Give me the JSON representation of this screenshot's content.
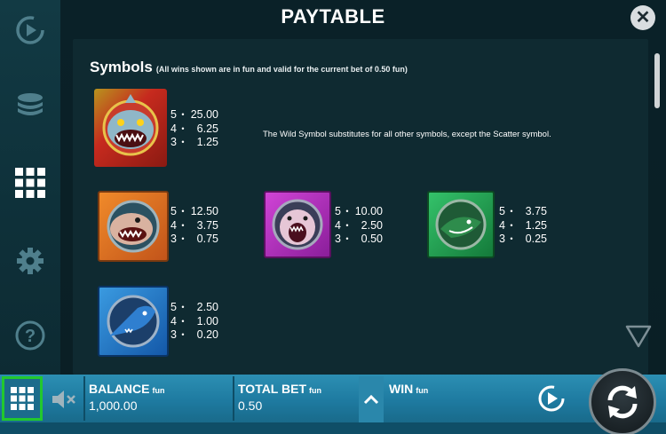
{
  "title": "PAYTABLE",
  "close_label": "✕",
  "sidebar": {
    "icons": [
      "replay-icon",
      "coins-icon",
      "paytable-grid-icon",
      "settings-gear-icon",
      "help-icon"
    ]
  },
  "symbols_section": {
    "heading": "Symbols",
    "note": "(All wins shown are in fun and valid for the current bet of 0.50 fun)",
    "wild_description": "The Wild Symbol substitutes for all other symbols, except the Scatter symbol."
  },
  "symbols": [
    {
      "name": "wild-shark",
      "pays": [
        [
          "5",
          "25.00"
        ],
        [
          "4",
          "6.25"
        ],
        [
          "3",
          "1.25"
        ]
      ]
    },
    {
      "name": "orange-shark",
      "pays": [
        [
          "5",
          "12.50"
        ],
        [
          "4",
          "3.75"
        ],
        [
          "3",
          "0.75"
        ]
      ]
    },
    {
      "name": "pink-shark",
      "pays": [
        [
          "5",
          "10.00"
        ],
        [
          "4",
          "2.50"
        ],
        [
          "3",
          "0.50"
        ]
      ]
    },
    {
      "name": "green-shark",
      "pays": [
        [
          "5",
          "3.75"
        ],
        [
          "4",
          "1.25"
        ],
        [
          "3",
          "0.25"
        ]
      ]
    },
    {
      "name": "blue-swordfish",
      "pays": [
        [
          "5",
          "2.50"
        ],
        [
          "4",
          "1.00"
        ],
        [
          "3",
          "0.20"
        ]
      ]
    }
  ],
  "dot": "•",
  "bottom": {
    "balance_label": "BALANCE",
    "balance_unit": "fun",
    "balance_value": "1,000.00",
    "total_bet_label": "TOTAL BET",
    "total_bet_unit": "fun",
    "total_bet_value": "0.50",
    "win_label": "WIN",
    "win_unit": "fun",
    "win_value": ""
  },
  "colors": {
    "menu_highlight": "#22c82e",
    "bar_blue": "#2c8fb3"
  }
}
